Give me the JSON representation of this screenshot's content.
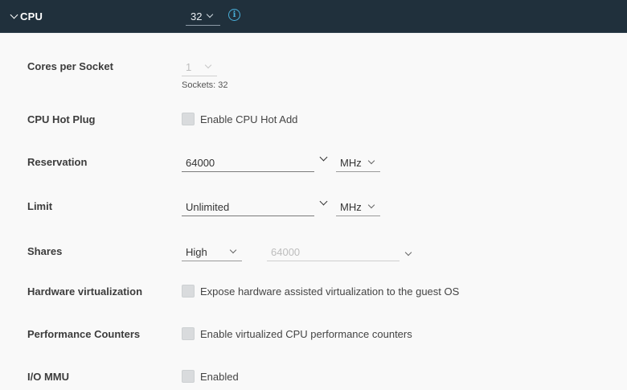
{
  "header": {
    "title": "CPU",
    "cpu_count": "32",
    "toggle_icon": "chevron-down-icon",
    "info_icon": "info-icon"
  },
  "fields": {
    "cores_per_socket": {
      "label": "Cores per Socket",
      "value": "1",
      "helper": "Sockets: 32"
    },
    "cpu_hot_plug": {
      "label": "CPU Hot Plug",
      "checkbox_label": "Enable CPU Hot Add",
      "checked": false
    },
    "reservation": {
      "label": "Reservation",
      "value": "64000",
      "unit": "MHz"
    },
    "limit": {
      "label": "Limit",
      "value": "Unlimited",
      "unit": "MHz"
    },
    "shares": {
      "label": "Shares",
      "level": "High",
      "value": "64000"
    },
    "hardware_virtualization": {
      "label": "Hardware virtualization",
      "checkbox_label": "Expose hardware assisted virtualization to the guest OS",
      "checked": false
    },
    "performance_counters": {
      "label": "Performance Counters",
      "checkbox_label": "Enable virtualized CPU performance counters",
      "checked": false
    },
    "io_mmu": {
      "label": "I/O MMU",
      "checkbox_label": "Enabled",
      "checked": false
    }
  },
  "colors": {
    "header_bg": "#20303c",
    "info_accent": "#49afd9",
    "body_bg": "#f9f9f9"
  }
}
